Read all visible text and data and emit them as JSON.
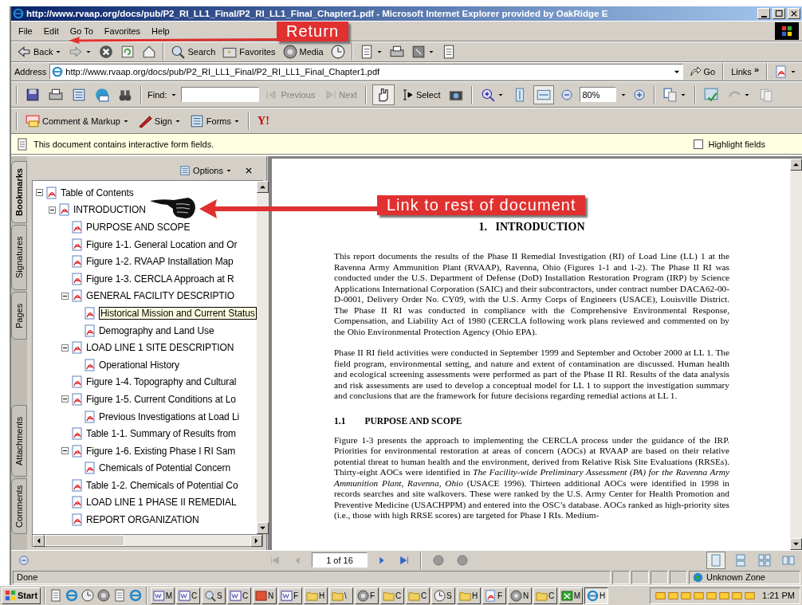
{
  "window": {
    "title": "http://www.rvaap.org/docs/pub/P2_RI_LL1_Final/P2_RI_LL1_Final_Chapter1.pdf - Microsoft Internet Explorer provided by OakRidge E"
  },
  "menu": [
    "File",
    "Edit",
    "Go To",
    "Favorites",
    "Help"
  ],
  "ie_toolbar": [
    {
      "kind": "back",
      "label": "Back"
    },
    {
      "kind": "forward"
    },
    {
      "kind": "stop"
    },
    {
      "kind": "refresh"
    },
    {
      "kind": "home"
    },
    {
      "kind": "search",
      "label": "Search"
    },
    {
      "kind": "favorites",
      "label": "Favorites"
    },
    {
      "kind": "media",
      "label": "Media"
    },
    {
      "kind": "history"
    },
    {
      "kind": "mail"
    },
    {
      "kind": "print"
    },
    {
      "kind": "fullscreen"
    },
    {
      "kind": "notes"
    }
  ],
  "address": {
    "label": "Address",
    "value": "http://www.rvaap.org/docs/pub/P2_RI_LL1_Final/P2_RI_LL1_Final_Chapter1.pdf",
    "go": "Go",
    "links": "Links",
    "chevron": "»"
  },
  "acrobat_toolbar": {
    "find_label": "Find:",
    "previous": "Previous",
    "next": "Next",
    "select": "Select",
    "zoom": "80%"
  },
  "tasks": [
    {
      "kind": "comment",
      "label": "Comment & Markup"
    },
    {
      "kind": "sign",
      "label": "Sign"
    },
    {
      "kind": "forms",
      "label": "Forms"
    },
    {
      "kind": "yahoo",
      "label": "Y!"
    }
  ],
  "info_bar": {
    "message": "This document contains interactive form fields.",
    "highlight_label": "Highlight fields",
    "highlight_checked": false
  },
  "nav_tabs": [
    {
      "label": "Bookmarks",
      "selected": true
    },
    {
      "label": "Signatures",
      "selected": false
    },
    {
      "label": "Pages",
      "selected": false
    },
    {
      "label": "Attachments",
      "selected": false
    },
    {
      "label": "Comments",
      "selected": false
    }
  ],
  "bookmarks": {
    "options": "Options",
    "tree": [
      {
        "label": "Table of Contents",
        "expanded": true,
        "children": [
          {
            "label": "INTRODUCTION",
            "expanded": true,
            "children": [
              {
                "label": "PURPOSE AND SCOPE"
              },
              {
                "label": "Figure 1-1. General Location and Or"
              },
              {
                "label": "Figure 1-2. RVAAP Installation Map"
              },
              {
                "label": "Figure 1-3. CERCLA Approach at R"
              },
              {
                "label": "GENERAL FACILITY DESCRIPTIO",
                "expanded": true,
                "children": [
                  {
                    "label": "Historical Mission and Current Status",
                    "hovered": true
                  },
                  {
                    "label": "Demography and Land Use",
                    "hovered": false
                  }
                ]
              },
              {
                "label": "LOAD LINE 1 SITE DESCRIPTION",
                "expanded": true,
                "children": [
                  {
                    "label": "Operational History"
                  }
                ]
              },
              {
                "label": "Figure 1-4. Topography and Cultural"
              },
              {
                "label": "Figure 1-5. Current Conditions at Lo",
                "expanded": true,
                "children": [
                  {
                    "label": "Previous Investigations at Load Li"
                  }
                ]
              },
              {
                "label": "Table 1-1. Summary of Results from"
              },
              {
                "label": "Figure 1-6. Existing Phase I RI Sam",
                "expanded": true,
                "children": [
                  {
                    "label": "Chemicals of Potential Concern"
                  }
                ]
              },
              {
                "label": "Table 1-2. Chemicals of Potential Co"
              },
              {
                "label": "LOAD LINE 1 PHASE II REMEDIAL"
              },
              {
                "label": "REPORT ORGANIZATION"
              }
            ]
          }
        ]
      }
    ]
  },
  "document": {
    "heading": "1.   INTRODUCTION",
    "paragraphs": [
      "This report documents the results of the Phase II Remedial Investigation (RI) of Load Line (LL) 1 at the Ravenna Army Ammunition Plant (RVAAP), Ravenna, Ohio (Figures 1-1 and 1-2). The Phase II RI was conducted under the U.S. Department of Defense (DoD) Installation Restoration Program (IRP) by Science Applications International Corporation (SAIC) and their subcontractors, under contract number DACA62-00-D-0001, Delivery Order No. CY09, with the U.S. Army Corps of Engineers (USACE), Louisville District. The Phase II RI was conducted in compliance with the Comprehensive Environmental Response, Compensation, and Liability Act of 1980 (CERCLA following work plans reviewed and commented on by the Ohio Environmental Protection Agency (Ohio EPA).",
      "Phase II RI field activities were conducted in September 1999 and September and October 2000 at LL 1. The field program, environmental setting, and nature and extent of contamination are discussed. Human health and ecological screening assessments were performed as part of the Phase II RI. Results of the data analysis and risk assessments are used to develop a conceptual model for LL 1 to support the investigation summary and conclusions that are the framework for future decisions regarding remedial actions at LL 1."
    ],
    "section_number": "1.1",
    "section_title": "PURPOSE AND SCOPE",
    "section_paragraphs": [
      "Figure 1-3 presents the approach to implementing the CERCLA process under the guidance of the IRP. Priorities for environmental restoration at areas of concern (AOCs) at RVAAP are based on their relative potential threat to human health and the environment, derived from Relative Risk Site Evaluations (RRSEs). Thirty-eight AOCs were identified in *The Facility-wide Preliminary Assessment (PA) for the Ravenna Army Ammunition Plant, Ravenna, Ohio* (USACE 1996). Thirteen additional AOCs were identified in 1998 in records searches and site walkovers. These were ranked by the U.S. Army Center for Health Promotion and Preventive Medicine (USACHPPM) and entered into the OSC’s database. AOCs ranked as high-priority sites (i.e., those with high RRSE scores) are targeted for Phase I RIs. Medium-"
    ]
  },
  "page_nav": {
    "page": "1 of 16"
  },
  "status_bar": {
    "text": "Done",
    "zone": "Unknown Zone"
  },
  "taskbar": {
    "start": "Start",
    "items": [
      {
        "kind": "word",
        "label": "M"
      },
      {
        "kind": "word",
        "label": "C"
      },
      {
        "kind": "search",
        "label": "S"
      },
      {
        "kind": "word",
        "label": "C"
      },
      {
        "kind": "ppt",
        "label": "N"
      },
      {
        "kind": "word",
        "label": "F"
      },
      {
        "kind": "folder",
        "label": "H"
      },
      {
        "kind": "folder",
        "label": "\\"
      },
      {
        "kind": "net",
        "label": "F"
      },
      {
        "kind": "folder",
        "label": "C"
      },
      {
        "kind": "folder",
        "label": "C"
      },
      {
        "kind": "clock",
        "label": "S"
      },
      {
        "kind": "folder",
        "label": "H"
      },
      {
        "kind": "pdf",
        "label": "F"
      },
      {
        "kind": "net",
        "label": "N"
      },
      {
        "kind": "folder",
        "label": "C"
      },
      {
        "kind": "excel",
        "label": "M"
      },
      {
        "kind": "ie",
        "label": "H",
        "selected": true
      }
    ],
    "clock": "1:21 PM"
  },
  "annotations": [
    {
      "kind": "return",
      "label": "Return"
    },
    {
      "kind": "link",
      "label": "Link to rest of document"
    }
  ]
}
